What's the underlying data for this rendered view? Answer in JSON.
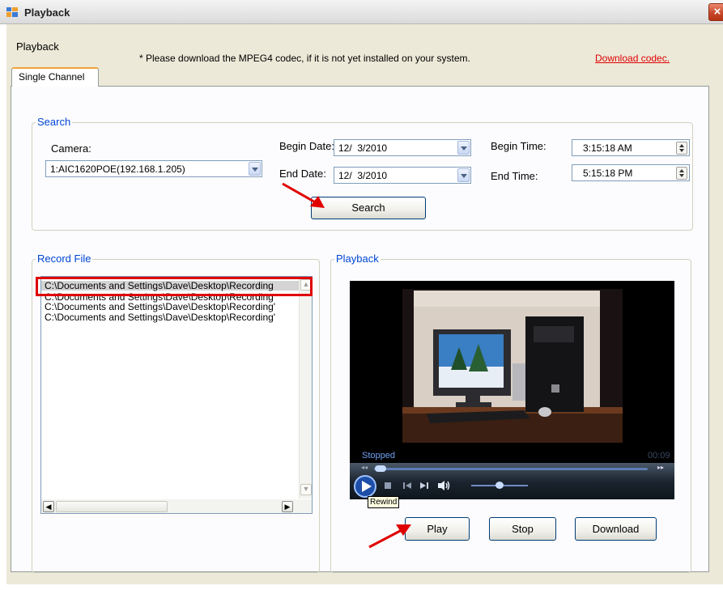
{
  "window": {
    "title": "Playback",
    "close_label": "×"
  },
  "header": {
    "label": "Playback",
    "notice": "* Please download the MPEG4 codec, if it is not yet installed on your system.",
    "download_link": "Download codec."
  },
  "tabs": [
    {
      "label": "Single Channel",
      "selected": true
    }
  ],
  "search": {
    "group_title": "Search",
    "camera_label": "Camera:",
    "camera_value": "1:AIC1620POE(192.168.1.205)",
    "begin_date_label": "Begin Date:",
    "begin_date_value": "12/  3/2010",
    "end_date_label": "End Date:",
    "end_date_value": "12/  3/2010",
    "begin_time_label": "Begin Time:",
    "begin_time_value": "3:15:18 AM",
    "end_time_label": "End Time:",
    "end_time_value": "5:15:18 PM",
    "search_button": "Search"
  },
  "record_file": {
    "group_title": "Record File",
    "items": [
      "C:\\Documents and Settings\\Dave\\Desktop\\Recording",
      "C:\\Documents and Settings\\Dave\\Desktop\\Recording",
      "C:\\Documents and Settings\\Dave\\Desktop\\Recording'",
      "C:\\Documents and Settings\\Dave\\Desktop\\Recording'"
    ],
    "selected_index": 0
  },
  "playback": {
    "group_title": "Playback",
    "status": "Stopped",
    "time": "00:09",
    "tooltip": "Rewind",
    "play_button": "Play",
    "stop_button": "Stop",
    "download_button": "Download"
  },
  "colors": {
    "accent_tab": "#f0a33a",
    "group_title": "#0046d5",
    "link": "#e00000",
    "annotation_arrow": "#e00000",
    "highlight_box": "#e00000"
  },
  "icons": [
    "window-app-icon",
    "close-icon",
    "chevron-down-icon",
    "spin-up-down-icon",
    "play-icon",
    "stop-icon",
    "previous-icon",
    "next-icon",
    "volume-icon",
    "annotation-arrow",
    "highlight-box"
  ]
}
